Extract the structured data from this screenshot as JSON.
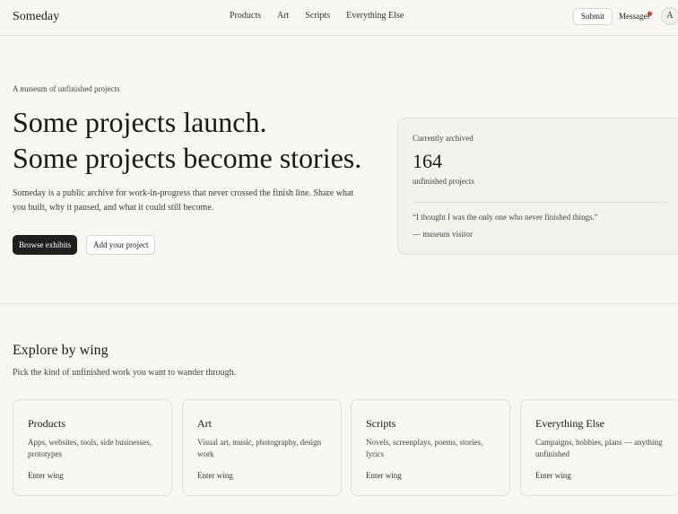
{
  "header": {
    "logo": "Someday",
    "nav": [
      "Products",
      "Art",
      "Scripts",
      "Everything Else"
    ],
    "submit_label": "Submit",
    "messages_label": "Messages",
    "avatar_initial": "A",
    "notification_color": "#d9342b"
  },
  "hero": {
    "eyebrow": "A museum of unfinished projects",
    "headline_line1": "Some projects launch.",
    "headline_line2": "Some projects become stories.",
    "intro": "Someday is a public archive for work-in-progress that never crossed the finish line. Share what you built, why it paused, and what it could still become.",
    "primary_cta": "Browse exhibits",
    "secondary_cta": "Add your project"
  },
  "stats": {
    "label": "Currently archived",
    "count": "164",
    "unit": "unfinished projects",
    "quote": "“I thought I was the only one who never finished things.”",
    "attribution": "— museum visitor"
  },
  "wings": {
    "title": "Explore by wing",
    "subtitle": "Pick the kind of unfinished work you want to wander through.",
    "items": [
      {
        "title": "Products",
        "description": "Apps, websites, tools, side businesses, prototypes",
        "link": "Enter wing"
      },
      {
        "title": "Art",
        "description": "Visual art, music, photography, design work",
        "link": "Enter wing"
      },
      {
        "title": "Scripts",
        "description": "Novels, screenplays, poems, stories, lyrics",
        "link": "Enter wing"
      },
      {
        "title": "Everything Else",
        "description": "Campaigns, hobbies, plans — anything unfinished",
        "link": "Enter wing"
      }
    ]
  }
}
